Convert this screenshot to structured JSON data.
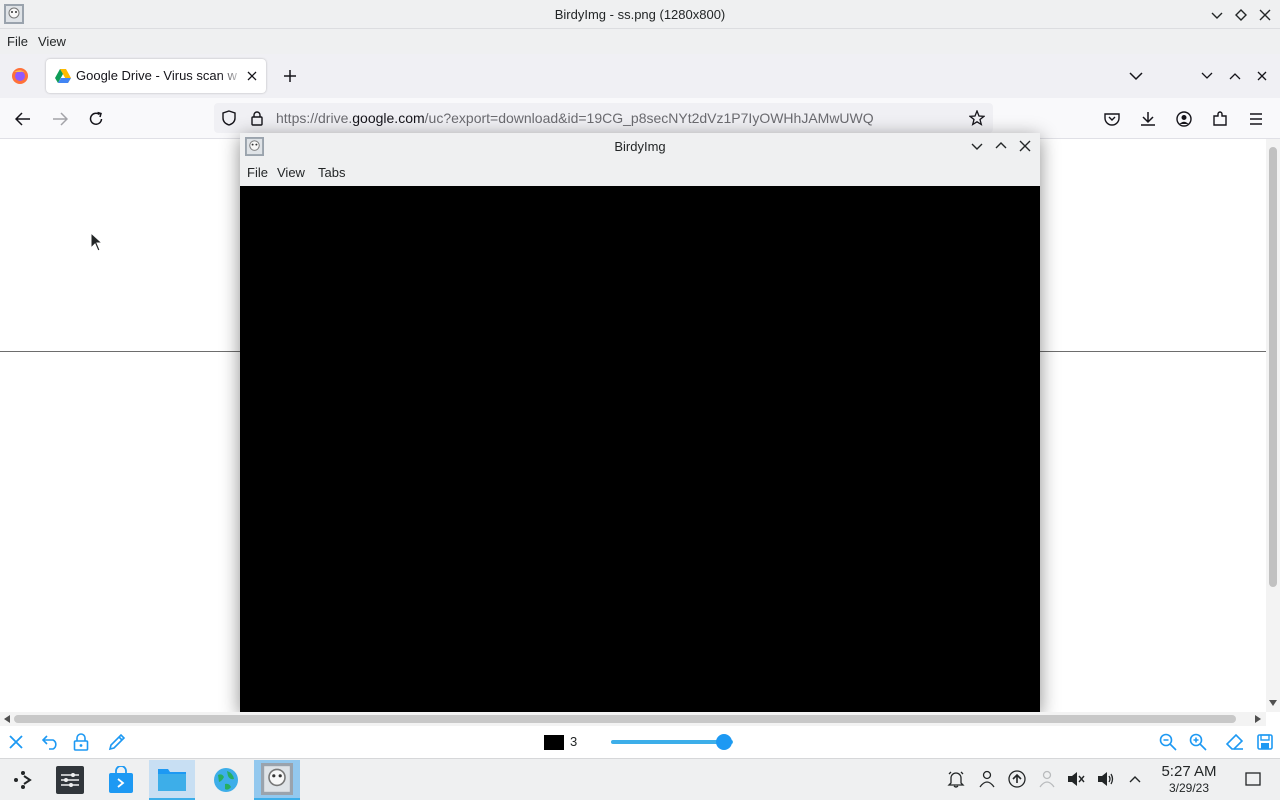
{
  "outer_window": {
    "title": "BirdyImg - ss.png (1280x800)",
    "menu": [
      "File",
      "View"
    ]
  },
  "browser": {
    "tab_title": "Google Drive - Virus scan w",
    "url_prefix": "https://drive.",
    "url_host": "google.com",
    "url_rest": "/uc?export=download&id=19CG_p8secNYt2dVz1P7IyOWHhJAMwUWQ"
  },
  "inner_window": {
    "title": "BirdyImg",
    "menu": [
      "File",
      "View",
      "Tabs"
    ]
  },
  "draw_toolbar": {
    "pen_size": "3",
    "color": "#000000",
    "slider_level": 0.93
  },
  "taskbar": {
    "time": "5:27 AM",
    "date": "3/29/23"
  },
  "colors": {
    "accent": "#3daee9",
    "chrome": "#eff0f1"
  }
}
